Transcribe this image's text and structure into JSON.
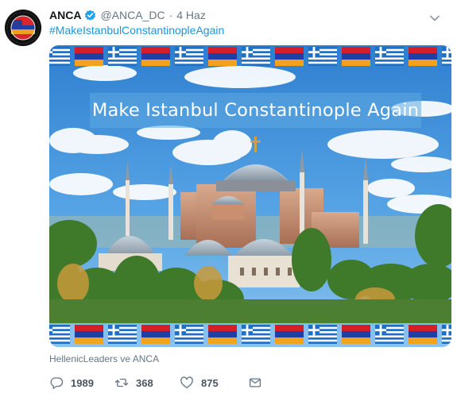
{
  "tweet": {
    "display_name": "ANCA",
    "handle": "@ANCA_DC",
    "separator": "·",
    "date": "4 Haz",
    "text": "#MakeIstanbulConstantinopleAgain",
    "image_caption": "Make Istanbul Constantinople Again",
    "tagged": "HellenicLeaders ve ANCA"
  },
  "actions": {
    "reply_count": "1989",
    "retweet_count": "368",
    "like_count": "875"
  },
  "colors": {
    "link": "#1b95e0",
    "verified": "#1da1f2",
    "muted": "#657786"
  },
  "icons": {
    "verified": "verified-badge-icon",
    "menu": "chevron-down-icon",
    "reply": "reply-icon",
    "retweet": "retweet-icon",
    "like": "heart-icon",
    "message": "envelope-icon"
  }
}
